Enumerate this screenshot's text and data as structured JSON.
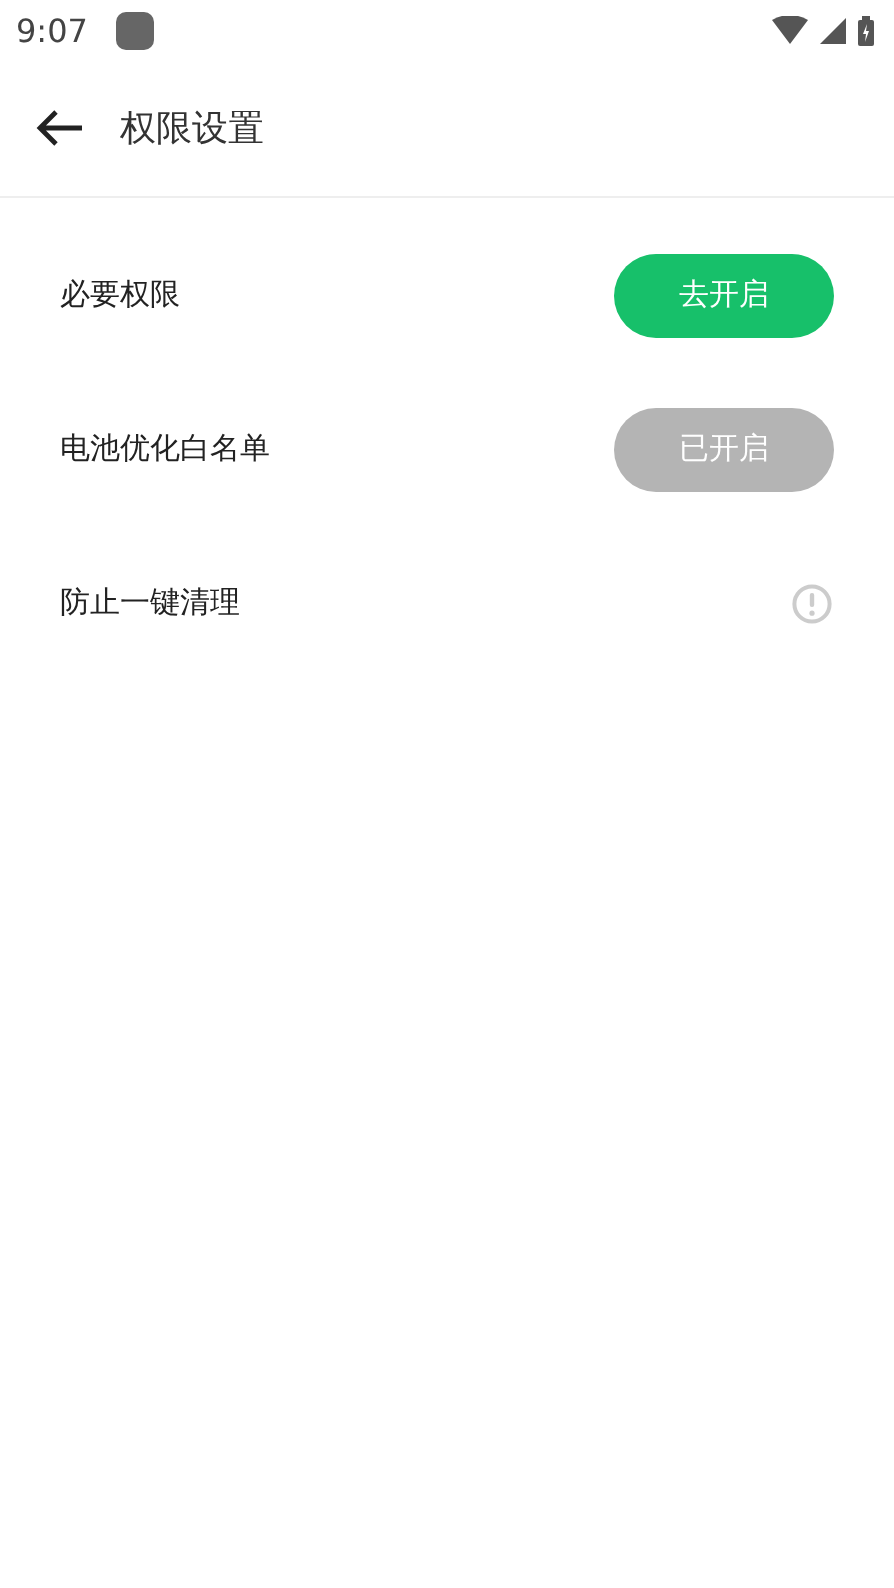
{
  "status_bar": {
    "time": "9:07"
  },
  "header": {
    "title": "权限设置"
  },
  "rows": [
    {
      "label": "必要权限",
      "kind": "button",
      "button": {
        "label": "去开启",
        "disabled": false
      }
    },
    {
      "label": "电池优化白名单",
      "kind": "button",
      "button": {
        "label": "已开启",
        "disabled": true
      }
    },
    {
      "label": "防止一键清理",
      "kind": "info"
    }
  ]
}
